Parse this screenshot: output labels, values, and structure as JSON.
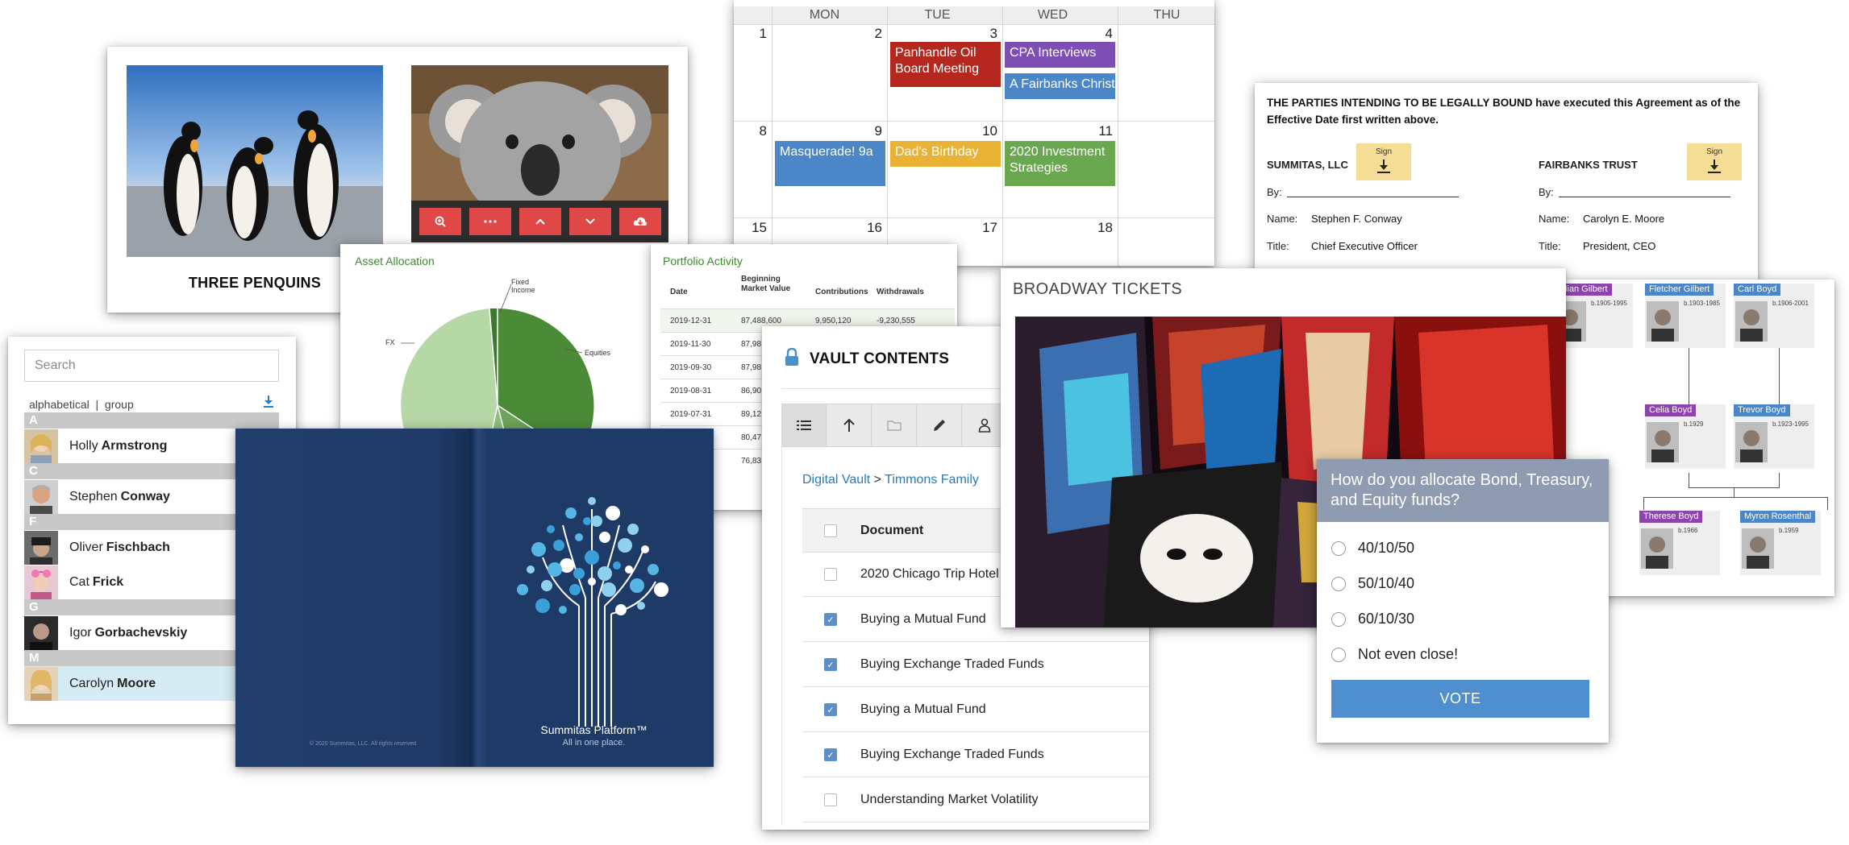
{
  "penguins": {
    "caption": "THREE PENQUINS"
  },
  "koala_toolbar": {
    "buttons": [
      "zoom-in-icon",
      "more-icon",
      "chevron-up-icon",
      "chevron-down-icon",
      "cloud-download-icon"
    ]
  },
  "calendar": {
    "days": [
      "MON",
      "TUE",
      "WED",
      "THU"
    ],
    "dates": {
      "d1": "1",
      "d2": "2",
      "d3": "3",
      "d4": "4",
      "d8": "8",
      "d9": "9",
      "d10": "10",
      "d11": "11",
      "d15": "15",
      "d16": "16",
      "d17": "17",
      "d18": "18"
    },
    "events": {
      "panhandle": "Panhandle Oil Board Meeting",
      "cpa": "CPA Interviews",
      "fairbanks": "A Fairbanks Christmas",
      "masquerade": "Masquerade! 9a",
      "birthday": "Dad's Birthday",
      "investment": "2020 Investment Strategies"
    },
    "colors": {
      "red": "#b5281f",
      "purple": "#7d4eb3",
      "blue": "#4a86c8",
      "yellow": "#e9b234",
      "green": "#6aa84f"
    }
  },
  "signature": {
    "intro": "THE PARTIES INTENDING TO BE LEGALLY BOUND have executed this Agreement as of the Effective Date first written above.",
    "sign_label": "Sign",
    "left": {
      "party": "SUMMITAS, LLC",
      "by": "By:",
      "name_label": "Name:",
      "name": "Stephen F. Conway",
      "title_label": "Title:",
      "title": "Chief Executive Officer"
    },
    "right": {
      "party": "FAIRBANKS TRUST",
      "by": "By:",
      "name_label": "Name:",
      "name": "Carolyn E. Moore",
      "title_label": "Title:",
      "title": "President, CEO"
    }
  },
  "contacts": {
    "search_placeholder": "Search",
    "mode": "alphabetical  |  group",
    "letters": [
      "A",
      "C",
      "F",
      "G",
      "M"
    ],
    "people": [
      {
        "first": "Holly",
        "last": "Armstrong"
      },
      {
        "first": "Stephen",
        "last": "Conway"
      },
      {
        "first": "Oliver",
        "last": "Fischbach"
      },
      {
        "first": "Cat",
        "last": "Frick"
      },
      {
        "first": "Igor",
        "last": "Gorbachevskiy"
      },
      {
        "first": "Carolyn",
        "last": "Moore"
      }
    ]
  },
  "asset": {
    "title": "Asset Allocation",
    "labels": {
      "fixed": "Fixed Income",
      "fx": "FX",
      "equities": "Equities"
    }
  },
  "portfolio": {
    "title": "Portfolio Activity",
    "headers": [
      "Date",
      "Beginning Market Value",
      "Contributions",
      "Withdrawals"
    ],
    "rows": [
      [
        "2019-12-31",
        "87,488,600",
        "9,950,120",
        "-9,230,555"
      ],
      [
        "2019-11-30",
        "87,98",
        "",
        ""
      ],
      [
        "2019-09-30",
        "87,98",
        "",
        ""
      ],
      [
        "2019-08-31",
        "86,90",
        "",
        ""
      ],
      [
        "2019-07-31",
        "89,12",
        "",
        ""
      ],
      [
        "",
        "80,47",
        "",
        ""
      ],
      [
        "",
        "76,83",
        "",
        ""
      ]
    ]
  },
  "book": {
    "copyright": "© 2020 Summitas, LLC. All rights reserved.",
    "brand": "Summitas Platform™",
    "tagline": "All in one place."
  },
  "vault": {
    "title": "VAULT CONTENTS",
    "breadcrumb_root": "Digital Vault",
    "breadcrumb_sep": " > ",
    "breadcrumb_current": "Timmons Family",
    "column": "Document",
    "documents": [
      {
        "name": "2020 Chicago Trip Hotel",
        "checked": false
      },
      {
        "name": "Buying a Mutual Fund",
        "checked": true
      },
      {
        "name": "Buying Exchange Traded Funds",
        "checked": true
      },
      {
        "name": "Buying a Mutual Fund",
        "checked": true
      },
      {
        "name": "Buying Exchange Traded Funds",
        "checked": true
      },
      {
        "name": "Understanding Market Volatility",
        "checked": false
      }
    ]
  },
  "tree": {
    "nodes": [
      {
        "name": "Lillian Gilbert",
        "years": "b.1905-1995",
        "color": "#8e44ad"
      },
      {
        "name": "Fletcher Gilbert",
        "years": "b.1903-1985",
        "color": "#4a86c8"
      },
      {
        "name": "Carl Boyd",
        "years": "b.1906-2001",
        "color": "#4a86c8"
      },
      {
        "name": "Celia Boyd",
        "years": "b.1929",
        "color": "#8e44ad"
      },
      {
        "name": "Trevor Boyd",
        "years": "b.1923-1995",
        "color": "#4a86c8"
      },
      {
        "name": "Therese Boyd",
        "years": "b.1966",
        "color": "#8e44ad"
      },
      {
        "name": "Myron Rosenthal",
        "years": "b.1959",
        "color": "#4a86c8"
      }
    ]
  },
  "broadway": {
    "title": "BROADWAY TICKETS"
  },
  "poll": {
    "question": "How do you allocate Bond, Treasury, and Equity funds?",
    "options": [
      "40/10/50",
      "50/10/40",
      "60/10/30",
      "Not even close!"
    ],
    "vote": "VOTE"
  }
}
